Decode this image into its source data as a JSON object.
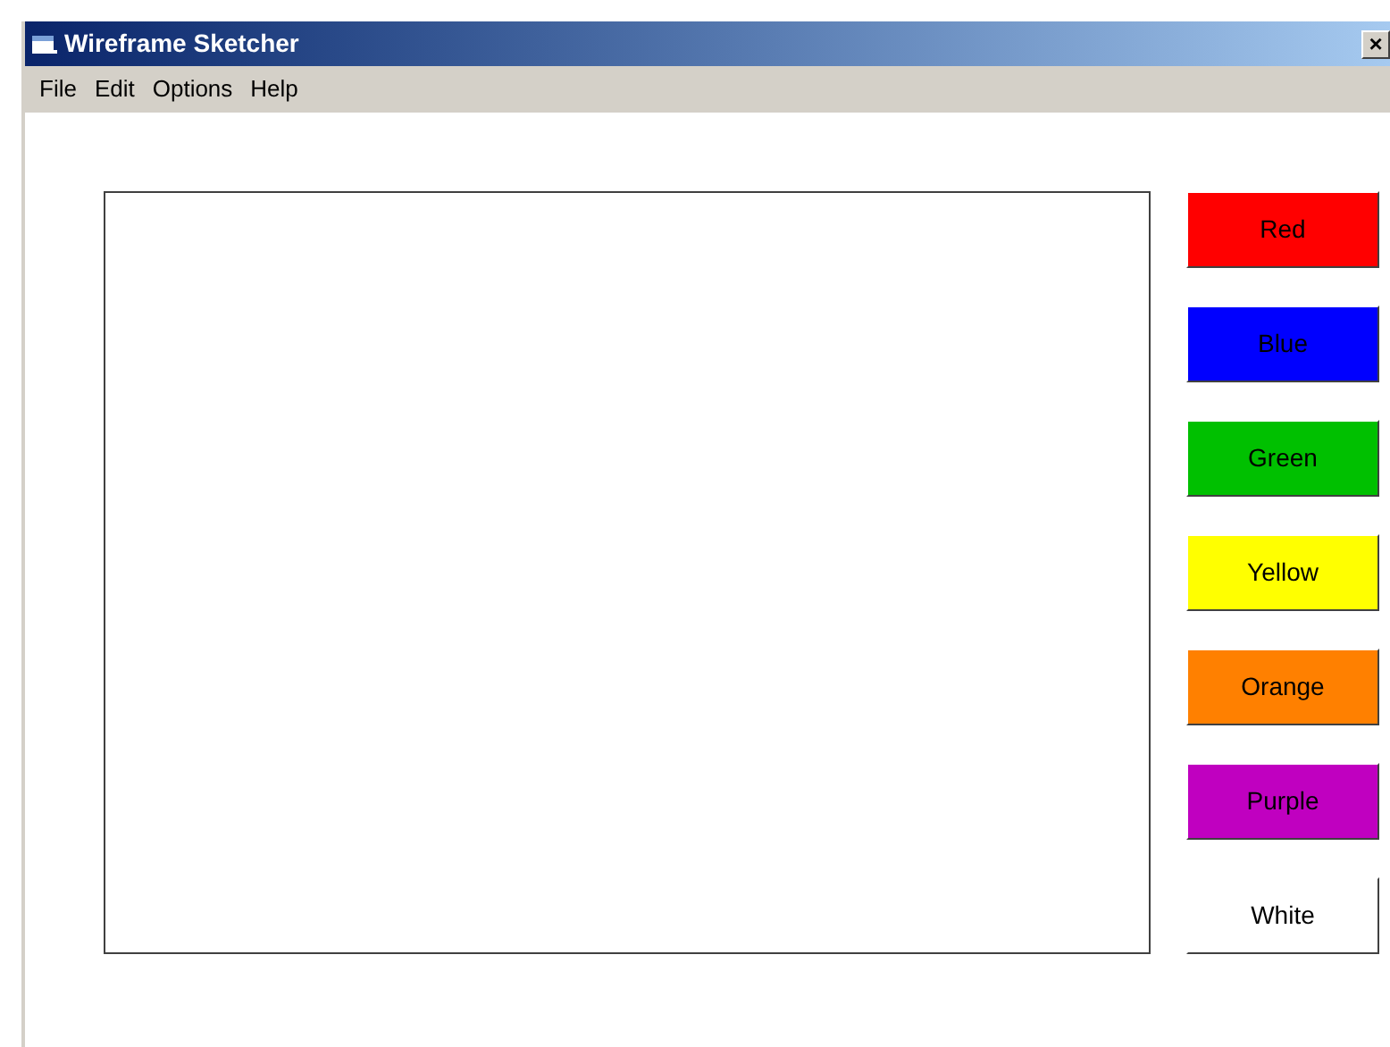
{
  "window": {
    "title": "Wireframe Sketcher",
    "close": "×"
  },
  "menu": [
    "File",
    "Edit",
    "Options",
    "Help"
  ],
  "color_buttons": [
    {
      "label": "Red",
      "color": "#ff0000"
    },
    {
      "label": "Blue",
      "color": "#0000ff"
    },
    {
      "label": "Green",
      "color": "#00c000"
    },
    {
      "label": "Yellow",
      "color": "#ffff00"
    },
    {
      "label": "Orange",
      "color": "#ff8000"
    },
    {
      "label": "Purple",
      "color": "#c000c0"
    },
    {
      "label": "White",
      "color": "#ffffff"
    }
  ]
}
